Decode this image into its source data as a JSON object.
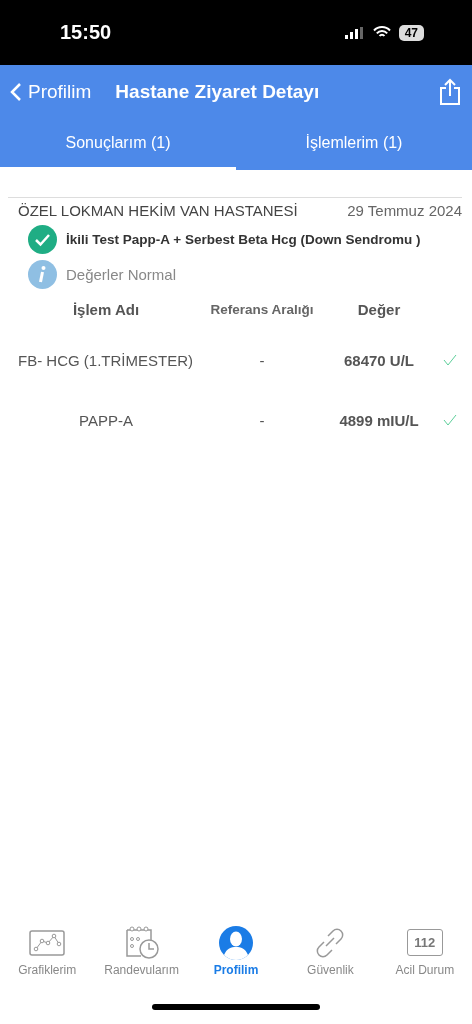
{
  "status_bar": {
    "time": "15:50",
    "battery": "47"
  },
  "nav": {
    "back_label": "Profilim",
    "title": "Hastane Ziyaret Detayı"
  },
  "tabs": [
    {
      "label": "Sonuçlarım (1)",
      "selected": true
    },
    {
      "label": "İşlemlerim (1)",
      "selected": false
    }
  ],
  "visit": {
    "hospital": "ÖZEL LOKMAN HEKİM VAN HASTANESİ",
    "date": "29 Temmuz 2024",
    "test": "İkili Test Papp-A + Serbest Beta Hcg (Down Sendromu )",
    "note": "Değerler Normal"
  },
  "table": {
    "columns": [
      "İşlem Adı",
      "Referans Aralığı",
      "Değer"
    ],
    "rows": [
      {
        "name": "FB- HCG (1.TRİMESTER)",
        "reference": "-",
        "value": "68470 U/L",
        "normal": true
      },
      {
        "name": "PAPP-A",
        "reference": "-",
        "value": "4899 mIU/L",
        "normal": true
      }
    ]
  },
  "tab_bar": [
    {
      "kind": "chart",
      "label": "Grafiklerim",
      "selected": false
    },
    {
      "kind": "calendar",
      "label": "Randevularım",
      "selected": false
    },
    {
      "kind": "profile",
      "label": "Profilim",
      "selected": true
    },
    {
      "kind": "link",
      "label": "Güvenlik",
      "selected": false
    },
    {
      "kind": "emergency",
      "label": "Acil Durum",
      "icon_text": "112",
      "selected": false
    }
  ]
}
